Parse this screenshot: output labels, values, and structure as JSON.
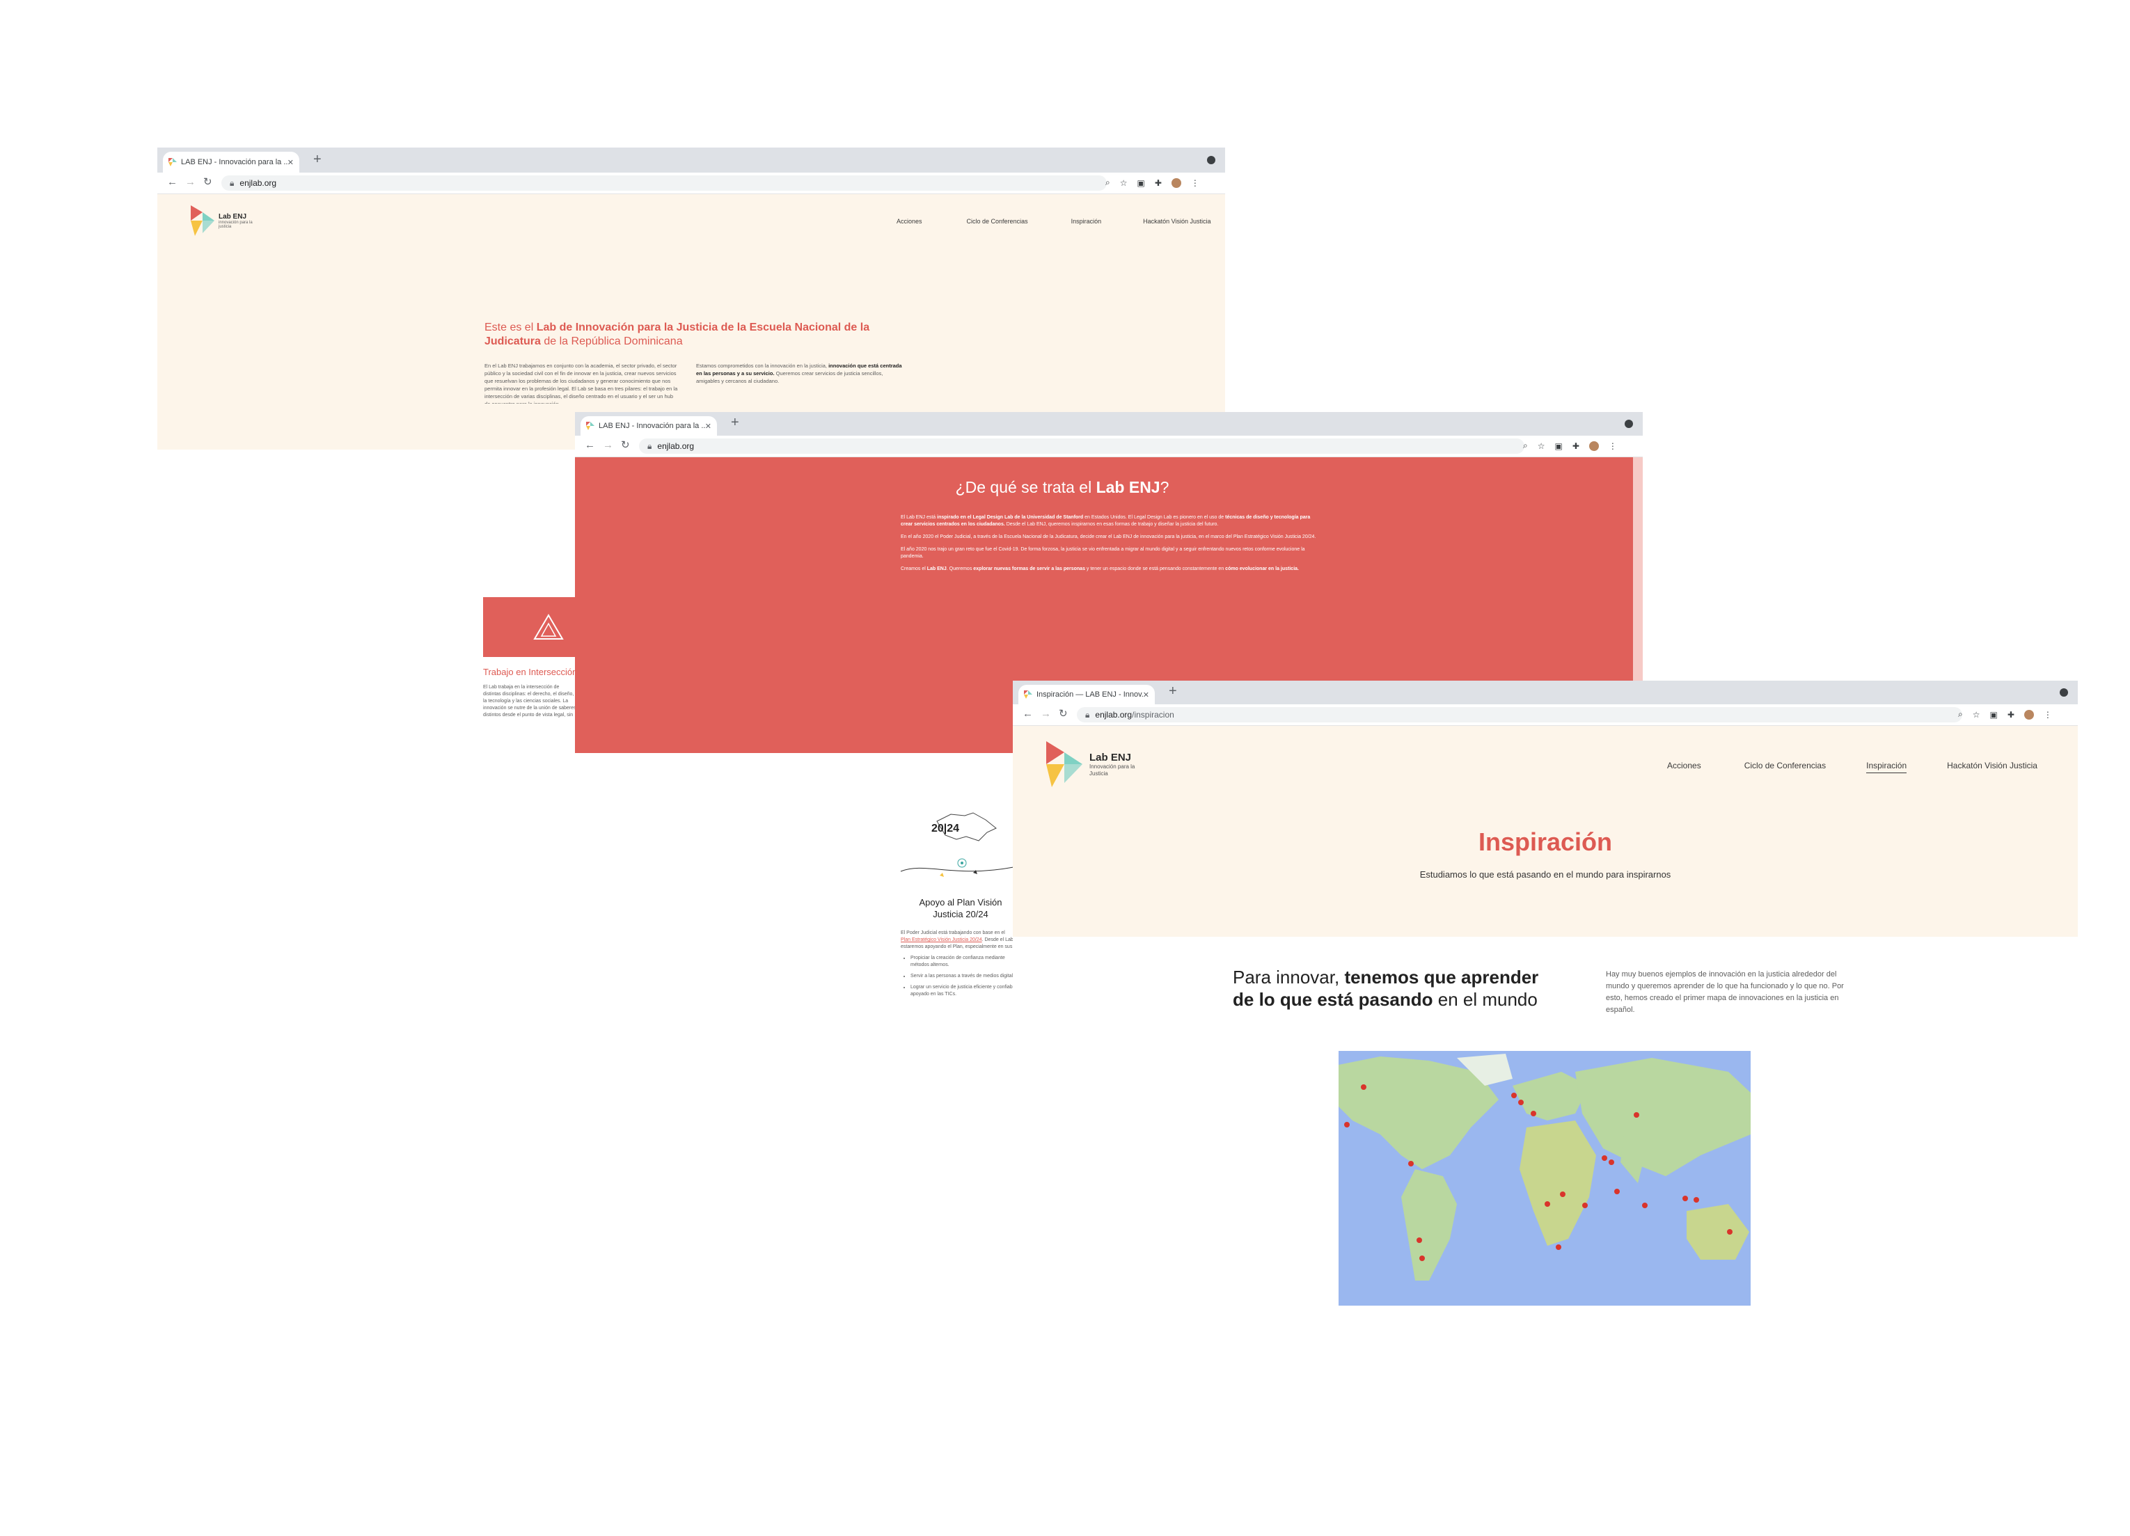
{
  "windows": {
    "w1": {
      "tab_title": "LAB ENJ - Innovación para la ...",
      "url": "enjlab.org",
      "logo_title": "Lab ENJ",
      "logo_sub": "innovación para la justicia",
      "nav": [
        "Acciones",
        "Ciclo de Conferencias",
        "Inspiración",
        "Hackatón Visión Justicia"
      ],
      "heading_a": "Este es el ",
      "heading_b": "Lab de Innovación para la Justicia de la Escuela Nacional de la Judicatura",
      "heading_c": " de la República Dominicana",
      "col1": "En el Lab ENJ trabajamos en conjunto con la academia, el sector privado, el sector público y la sociedad civil con el fin de innovar en la justicia, crear nuevos servicios que resuelvan los problemas de los ciudadanos y generar conocimiento que nos permita innovar en la profesión legal. El Lab se basa en tres pilares: el trabajo en la intersección de varias disciplinas, el diseño centrado en el usuario y el ser un hub de encuentro para la innovación.",
      "col2_a": "Estamos comprometidos con la innovación en la justicia, ",
      "col2_b": "innovación que está centrada en las personas y a su servicio.",
      "col2_c": " Queremos crear servicios de justicia sencillos, amigables y cercanos al ciudadano.",
      "card_title": "Trabajo en Intersección",
      "card_text": "El Lab trabaja en la intersección de distintas disciplinas: el derecho, el diseño, la tecnología y las ciencias sociales. La innovación se nutre de la unión de saberes distintos desde el punto de vista legal, sin excluir saberes que aportan a comprender lo que sucede en el ámbito.",
      "vision_badge": "20|24",
      "vision_title": "Apoyo al Plan Visión Justicia 20/24",
      "vision_text_a": "El Poder Judicial está trabajando con base en el ",
      "vision_link": "Plan Estratégico Visión Justicia 20/24",
      "vision_text_b": ". Desde el Lab estaremos apoyando el Plan, especialmente en sus pilares:",
      "vision_bullets": [
        "Propiciar la creación de confianza mediante métodos alternos.",
        "Servir a las personas a través de medios digitales.",
        "Lograr un servicio de justicia eficiente y confiable apoyado en las TICs."
      ]
    },
    "w2": {
      "tab_title": "LAB ENJ - Innovación para la ...",
      "url": "enjlab.org",
      "heading_a": "¿De qué se trata el ",
      "heading_b": "Lab ENJ",
      "heading_c": "?",
      "p1_a": "El Lab ENJ está ",
      "p1_b": "inspirado en el Legal Design Lab de la Universidad de Stanford",
      "p1_c": " en Estados Unidos. El Legal Design Lab es pionero en el uso de ",
      "p1_d": "técnicas de diseño y tecnología para crear servicios centrados en los ciudadanos.",
      "p1_e": " Desde el Lab ENJ, queremos inspirarnos en esas formas de trabajo y diseñar la justicia del futuro.",
      "p2": "En el año 2020 el Poder Judicial, a través de la Escuela Nacional de la Judicatura, decide crear el Lab ENJ de innovación para la justicia, en el marco del Plan Estratégico Visión Justicia 20/24.",
      "p3": "El año 2020 nos trajo un gran reto que fue el Covid-19. De forma forzosa, la justicia se vio enfrentada a migrar al mundo digital y a seguir enfrentando nuevos retos conforme evolucione la pandemia.",
      "p4_a": "Creamos el ",
      "p4_b": "Lab ENJ",
      "p4_c": ". Queremos ",
      "p4_d": "explorar nuevas formas de servir a las personas",
      "p4_e": " y tener un espacio donde se está pensando constantemente en ",
      "p4_f": "cómo evolucionar en la justicia."
    },
    "w3": {
      "tab_title": "Inspiración — LAB ENJ - Innov...",
      "url_a": "enjlab.org",
      "url_b": "/inspiracion",
      "logo_title": "Lab ENJ",
      "logo_sub": "Innovación para la Justicia",
      "nav": [
        "Acciones",
        "Ciclo de Conferencias",
        "Inspiración",
        "Hackatón Visión Justicia"
      ],
      "active_nav": "Inspiración",
      "hero_title": "Inspiración",
      "hero_sub": "Estudiamos lo que está pasando en el mundo para inspirarnos",
      "section_a": "Para innovar, ",
      "section_b": "tenemos que aprender de lo que está pasando",
      "section_c": " en el mundo",
      "section_text": "Hay muy buenos ejemplos de innovación en la justicia alrededor del mundo y queremos aprender de lo que ha funcionado y lo que no. Por esto, hemos creado el primer mapa de innovaciones en la justicia en español."
    }
  },
  "colors": {
    "brand_red": "#dd5a52",
    "coral": "#e0605a",
    "cream": "#fdf5ea",
    "chrome": "#dee1e6",
    "ocean": "#9ab7ef",
    "land": "#b9d7a0",
    "pin": "#d9342b"
  },
  "icons": [
    "favicon-icon",
    "close-icon",
    "plus-icon",
    "back-icon",
    "forward-icon",
    "reload-icon",
    "lock-icon",
    "zoom-icon",
    "star-icon",
    "qr-icon",
    "extensions-icon",
    "profile-icon",
    "menu-icon",
    "triangle-icon",
    "map-pin-icon"
  ]
}
